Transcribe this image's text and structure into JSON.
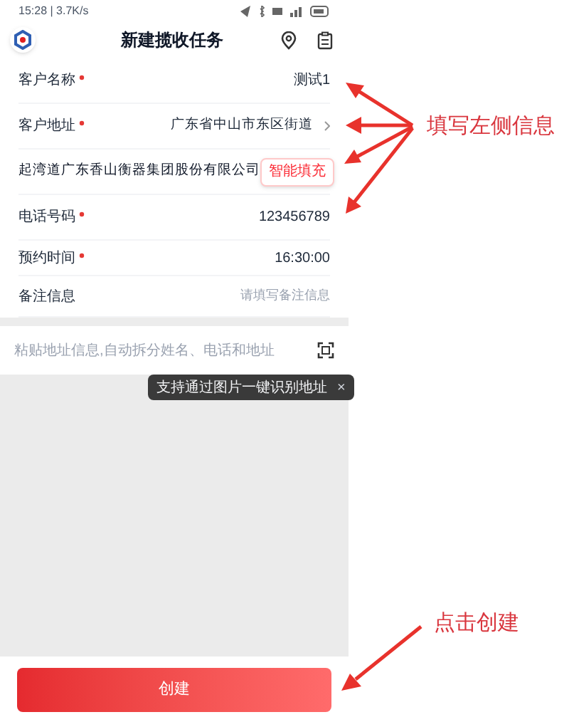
{
  "status_bar": {
    "text": "15:28 | 3.7K/s"
  },
  "header": {
    "title": "新建揽收任务"
  },
  "fields": [
    {
      "kind": "text",
      "label": "客户名称",
      "required": true,
      "value": "测试1"
    },
    {
      "kind": "link",
      "label": "客户地址",
      "required": true,
      "value": "广东省中山市东区街道"
    },
    {
      "kind": "smart",
      "label": "起湾道广东香山衡器集团股份有限公司",
      "required": false,
      "button": "智能填充"
    },
    {
      "kind": "text",
      "label": "电话号码",
      "required": true,
      "value": "123456789"
    },
    {
      "kind": "text",
      "label": "预约时间",
      "required": true,
      "value": "16:30:00"
    },
    {
      "kind": "text",
      "label": "备注信息",
      "required": false,
      "placeholder": "请填写备注信息"
    }
  ],
  "paste": {
    "placeholder": "粘贴地址信息,自动拆分姓名、电话和地址",
    "tooltip": "支持通过图片一键识别地址",
    "tooltip_close": "×"
  },
  "create_button": "创建",
  "annotations": [
    "填写左侧信息",
    "点击创建"
  ]
}
